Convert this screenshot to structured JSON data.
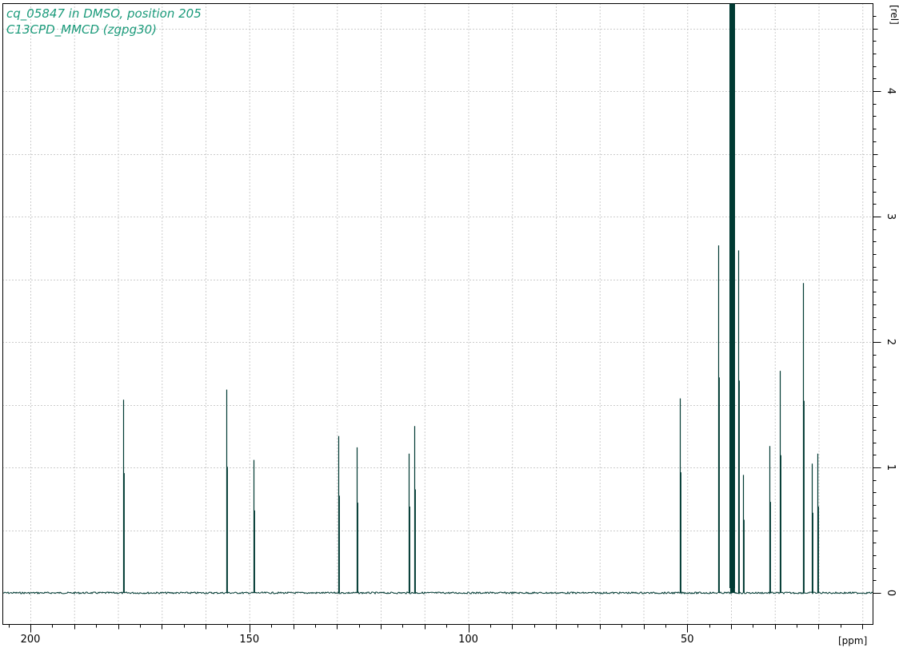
{
  "title_lines": [
    "cq_05847 in DMSO, position 205",
    "C13CPD_MMCD (zgpg30)"
  ],
  "colors": {
    "spectrum": "#003a33",
    "title": "#1a9a7a",
    "grid": "#9a9a9a",
    "axis": "#000000"
  },
  "chart_data": {
    "type": "line",
    "title": "",
    "xlabel": "[ppm]",
    "ylabel": "[rel]",
    "xlim": [
      202,
      181
    ],
    "x_reversed": true,
    "ylim": [
      -0.22,
      4.72
    ],
    "grid": true,
    "x_ticks": [
      200,
      150,
      100,
      50
    ],
    "y_ticks": [
      0,
      1,
      2,
      3,
      4
    ],
    "x_tick_labels": [
      "200",
      "150",
      "100",
      "50"
    ],
    "y_tick_labels": [
      "0",
      "1",
      "2",
      "3",
      "4"
    ],
    "series": [
      {
        "peaks": [
          {
            "ppm": 178.9,
            "height": 1.54
          },
          {
            "ppm": 155.2,
            "height": 1.62
          },
          {
            "ppm": 149.1,
            "height": 1.06
          },
          {
            "ppm": 129.6,
            "height": 1.25
          },
          {
            "ppm": 125.4,
            "height": 1.16
          },
          {
            "ppm": 113.6,
            "height": 1.11
          },
          {
            "ppm": 112.4,
            "height": 1.33
          },
          {
            "ppm": 51.7,
            "height": 1.55
          },
          {
            "ppm": 43.0,
            "height": 2.77
          },
          {
            "ppm": 40.2,
            "height": 4.72
          },
          {
            "ppm": 40.0,
            "height": 4.72
          },
          {
            "ppm": 39.8,
            "height": 4.72
          },
          {
            "ppm": 39.6,
            "height": 4.72
          },
          {
            "ppm": 39.4,
            "height": 4.72
          },
          {
            "ppm": 38.4,
            "height": 2.73
          },
          {
            "ppm": 37.3,
            "height": 0.94
          },
          {
            "ppm": 31.3,
            "height": 1.17
          },
          {
            "ppm": 28.9,
            "height": 1.77
          },
          {
            "ppm": 23.6,
            "height": 2.47
          },
          {
            "ppm": 21.5,
            "height": 1.03
          },
          {
            "ppm": 20.2,
            "height": 1.11
          }
        ]
      }
    ]
  }
}
